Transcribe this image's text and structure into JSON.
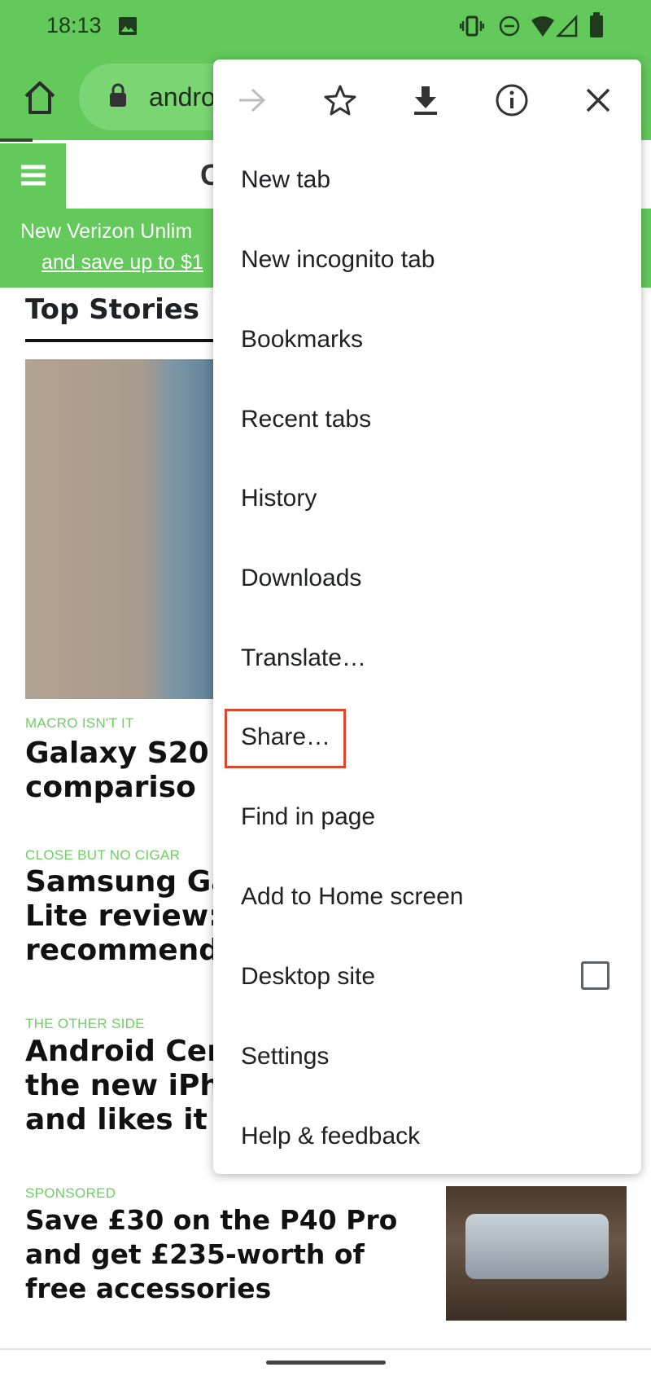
{
  "status_bar": {
    "time": "18:13",
    "icons": [
      "image-icon",
      "vibrate-icon",
      "do-not-disturb-icon",
      "wifi-icon",
      "signal-icon",
      "battery-icon"
    ]
  },
  "toolbar": {
    "url": "andro",
    "icons": [
      "home-icon",
      "lock-icon"
    ]
  },
  "site": {
    "header_letter": "C",
    "banner_line1": "New Verizon Unlim",
    "banner_line2": "and save up to $1",
    "top_stories": "Top Stories"
  },
  "articles": [
    {
      "kicker": "MACRO ISN'T IT",
      "headline": "Galaxy S20\ncompariso"
    },
    {
      "kicker": "CLOSE BUT NO CIGAR",
      "headline": "Samsung Ga\nLite review: T\nrecommend"
    },
    {
      "kicker": "THE OTHER SIDE",
      "headline": "Android Cen\nthe new iPho\nand likes it a"
    },
    {
      "kicker": "SPONSORED",
      "headline": "Save £30 on the P40 Pro\nand get £235-worth of\nfree accessories"
    }
  ],
  "menu": {
    "top_icons": [
      "forward-icon",
      "bookmark-star-icon",
      "download-icon",
      "info-icon",
      "close-icon"
    ],
    "items": [
      "New tab",
      "New incognito tab",
      "Bookmarks",
      "Recent tabs",
      "History",
      "Downloads",
      "Translate…",
      "Share…",
      "Find in page",
      "Add to Home screen",
      "Desktop site",
      "Settings",
      "Help & feedback"
    ],
    "desktop_site_checked": false,
    "highlighted_item": "Share…",
    "highlight_color": "#d9472f"
  },
  "colors": {
    "brand_green": "#62c95a",
    "kicker_green": "#6dcf63"
  }
}
